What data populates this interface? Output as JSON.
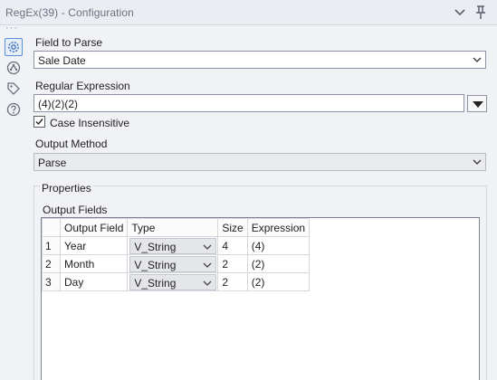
{
  "window": {
    "title": "RegEx(39) - Configuration"
  },
  "icons": {
    "collapse": "chevron-down-icon",
    "pin": "pin-icon",
    "configuration": "gear-icon",
    "connections": "nodes-icon",
    "annotation": "tag-icon",
    "help": "question-icon"
  },
  "form": {
    "field_to_parse_label": "Field to Parse",
    "field_to_parse_value": "Sale Date",
    "regex_label": "Regular Expression",
    "regex_value": "(4)(2)(2)",
    "case_insensitive_label": "Case Insensitive",
    "case_insensitive_checked": true,
    "output_method_label": "Output Method",
    "output_method_value": "Parse"
  },
  "properties": {
    "legend": "Properties",
    "output_fields_label": "Output Fields",
    "columns": [
      "Output Field",
      "Type",
      "Size",
      "Expression"
    ],
    "rows": [
      {
        "num": "1",
        "field": "Year",
        "type": "V_String",
        "size": "4",
        "expression": "(4)"
      },
      {
        "num": "2",
        "field": "Month",
        "type": "V_String",
        "size": "2",
        "expression": "(2)"
      },
      {
        "num": "3",
        "field": "Day",
        "type": "V_String",
        "size": "2",
        "expression": "(2)"
      }
    ]
  },
  "colors": {
    "accent": "#5c8fd6",
    "background": "#f1f2f5",
    "titlebar": "#ebedf2"
  }
}
